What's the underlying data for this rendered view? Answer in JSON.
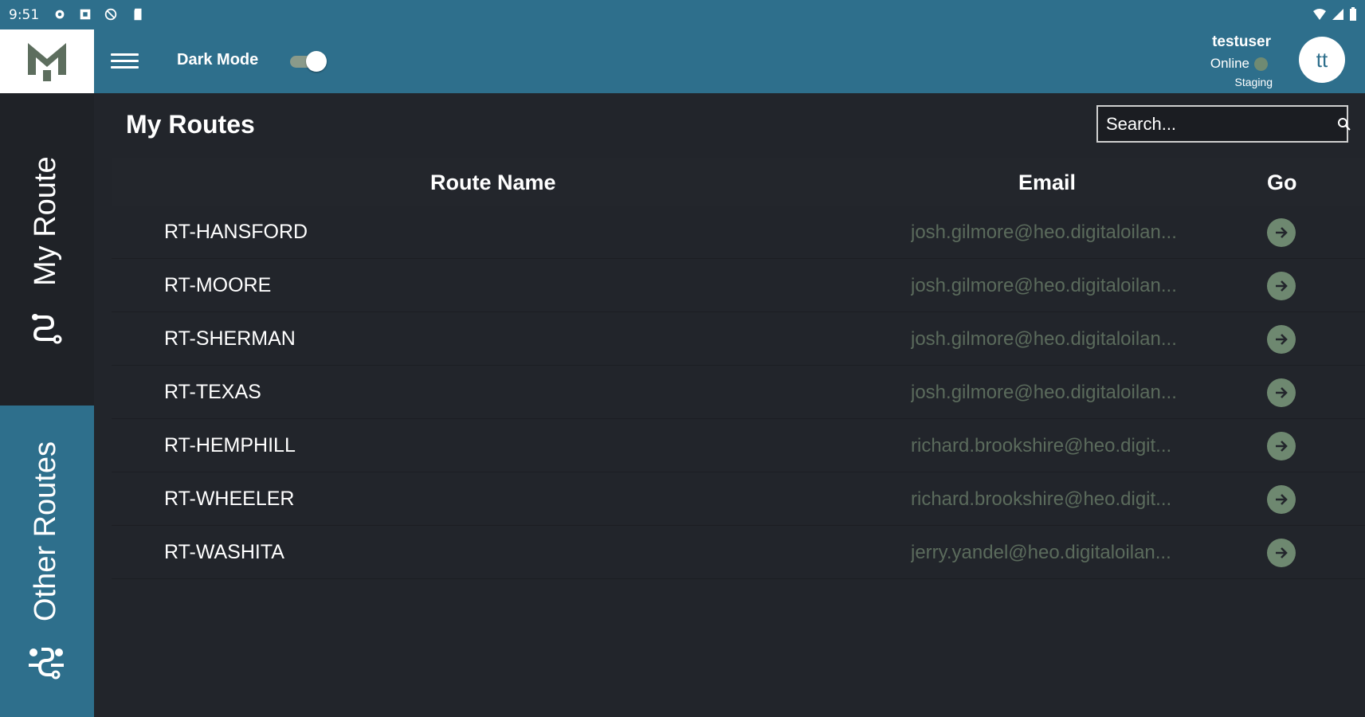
{
  "status_bar": {
    "time": "9:51"
  },
  "header": {
    "dark_mode_label": "Dark Mode",
    "dark_mode_on": true,
    "user": {
      "name": "testuser",
      "status": "Online",
      "environment": "Staging",
      "initials": "tt"
    }
  },
  "sidebar": {
    "items": [
      {
        "label": "My Route",
        "icon": "route-icon",
        "active": true
      },
      {
        "label": "Other Routes",
        "icon": "group-routes-icon",
        "active": false
      }
    ]
  },
  "main": {
    "title": "My Routes",
    "search": {
      "placeholder": "Search...",
      "value": ""
    },
    "columns": [
      "Route Name",
      "Email",
      "Go"
    ],
    "rows": [
      {
        "name": "RT-HANSFORD",
        "email": "josh.gilmore@heo.digitaloilan..."
      },
      {
        "name": "RT-MOORE",
        "email": "josh.gilmore@heo.digitaloilan..."
      },
      {
        "name": "RT-SHERMAN",
        "email": "josh.gilmore@heo.digitaloilan..."
      },
      {
        "name": "RT-TEXAS",
        "email": "josh.gilmore@heo.digitaloilan..."
      },
      {
        "name": "RT-HEMPHILL",
        "email": "richard.brookshire@heo.digit..."
      },
      {
        "name": "RT-WHEELER",
        "email": "richard.brookshire@heo.digit..."
      },
      {
        "name": "RT-WASHITA",
        "email": "jerry.yandel@heo.digitaloilan..."
      }
    ]
  },
  "colors": {
    "header_bg": "#2e6f8c",
    "page_bg": "#22252b",
    "go_button": "#6e8870",
    "email_text": "#5b6b5c",
    "online_dot": "#6f8a72"
  }
}
